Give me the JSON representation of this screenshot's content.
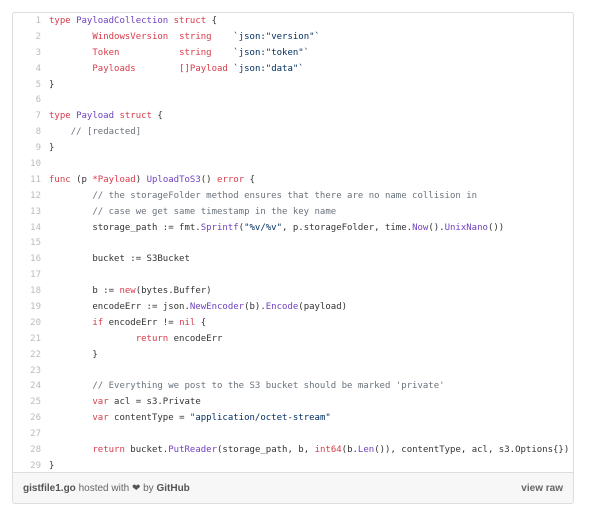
{
  "code_lines": [
    [
      {
        "t": "type ",
        "c": "k"
      },
      {
        "t": "PayloadCollection",
        "c": "f"
      },
      {
        "t": " ",
        "c": "tx"
      },
      {
        "t": "struct",
        "c": "k"
      },
      {
        "t": " {",
        "c": "tx"
      }
    ],
    [
      {
        "t": "        ",
        "c": "tx"
      },
      {
        "t": "WindowsVersion",
        "c": "k"
      },
      {
        "t": "  ",
        "c": "tx"
      },
      {
        "t": "string",
        "c": "k"
      },
      {
        "t": "    ",
        "c": "tx"
      },
      {
        "t": "`json:\"version\"`",
        "c": "s"
      }
    ],
    [
      {
        "t": "        ",
        "c": "tx"
      },
      {
        "t": "Token",
        "c": "k"
      },
      {
        "t": "           ",
        "c": "tx"
      },
      {
        "t": "string",
        "c": "k"
      },
      {
        "t": "    ",
        "c": "tx"
      },
      {
        "t": "`json:\"token\"`",
        "c": "s"
      }
    ],
    [
      {
        "t": "        ",
        "c": "tx"
      },
      {
        "t": "Payloads",
        "c": "k"
      },
      {
        "t": "        ",
        "c": "tx"
      },
      {
        "t": "[]Payload",
        "c": "k"
      },
      {
        "t": " ",
        "c": "tx"
      },
      {
        "t": "`json:\"data\"`",
        "c": "s"
      }
    ],
    [
      {
        "t": "}",
        "c": "tx"
      }
    ],
    [],
    [
      {
        "t": "type ",
        "c": "k"
      },
      {
        "t": "Payload",
        "c": "f"
      },
      {
        "t": " ",
        "c": "tx"
      },
      {
        "t": "struct",
        "c": "k"
      },
      {
        "t": " {",
        "c": "tx"
      }
    ],
    [
      {
        "t": "    ",
        "c": "tx"
      },
      {
        "t": "// [redacted]",
        "c": "c"
      }
    ],
    [
      {
        "t": "}",
        "c": "tx"
      }
    ],
    [],
    [
      {
        "t": "func",
        "c": "k"
      },
      {
        "t": " (p ",
        "c": "tx"
      },
      {
        "t": "*Payload",
        "c": "k"
      },
      {
        "t": ") ",
        "c": "tx"
      },
      {
        "t": "UploadToS3",
        "c": "f"
      },
      {
        "t": "() ",
        "c": "tx"
      },
      {
        "t": "error",
        "c": "k"
      },
      {
        "t": " {",
        "c": "tx"
      }
    ],
    [
      {
        "t": "        ",
        "c": "tx"
      },
      {
        "t": "// the storageFolder method ensures that there are no name collision in",
        "c": "c"
      }
    ],
    [
      {
        "t": "        ",
        "c": "tx"
      },
      {
        "t": "// case we get same timestamp in the key name",
        "c": "c"
      }
    ],
    [
      {
        "t": "        storage_path := fmt.",
        "c": "tx"
      },
      {
        "t": "Sprintf",
        "c": "f"
      },
      {
        "t": "(",
        "c": "tx"
      },
      {
        "t": "\"%v/%v\"",
        "c": "s"
      },
      {
        "t": ", p.storageFolder, time.",
        "c": "tx"
      },
      {
        "t": "Now",
        "c": "f"
      },
      {
        "t": "().",
        "c": "tx"
      },
      {
        "t": "UnixNano",
        "c": "f"
      },
      {
        "t": "())",
        "c": "tx"
      }
    ],
    [],
    [
      {
        "t": "        bucket := S3Bucket",
        "c": "tx"
      }
    ],
    [],
    [
      {
        "t": "        b := ",
        "c": "tx"
      },
      {
        "t": "new",
        "c": "k"
      },
      {
        "t": "(bytes.Buffer)",
        "c": "tx"
      }
    ],
    [
      {
        "t": "        encodeErr := json.",
        "c": "tx"
      },
      {
        "t": "NewEncoder",
        "c": "f"
      },
      {
        "t": "(b).",
        "c": "tx"
      },
      {
        "t": "Encode",
        "c": "f"
      },
      {
        "t": "(payload)",
        "c": "tx"
      }
    ],
    [
      {
        "t": "        ",
        "c": "tx"
      },
      {
        "t": "if",
        "c": "k"
      },
      {
        "t": " encodeErr != ",
        "c": "tx"
      },
      {
        "t": "nil",
        "c": "k"
      },
      {
        "t": " {",
        "c": "tx"
      }
    ],
    [
      {
        "t": "                ",
        "c": "tx"
      },
      {
        "t": "return",
        "c": "k"
      },
      {
        "t": " encodeErr",
        "c": "tx"
      }
    ],
    [
      {
        "t": "        }",
        "c": "tx"
      }
    ],
    [],
    [
      {
        "t": "        ",
        "c": "tx"
      },
      {
        "t": "// Everything we post to the S3 bucket should be marked 'private'",
        "c": "c"
      }
    ],
    [
      {
        "t": "        ",
        "c": "tx"
      },
      {
        "t": "var",
        "c": "k"
      },
      {
        "t": " acl = s3.Private",
        "c": "tx"
      }
    ],
    [
      {
        "t": "        ",
        "c": "tx"
      },
      {
        "t": "var",
        "c": "k"
      },
      {
        "t": " contentType = ",
        "c": "tx"
      },
      {
        "t": "\"application/octet-stream\"",
        "c": "s"
      }
    ],
    [],
    [
      {
        "t": "        ",
        "c": "tx"
      },
      {
        "t": "return",
        "c": "k"
      },
      {
        "t": " bucket.",
        "c": "tx"
      },
      {
        "t": "PutReader",
        "c": "f"
      },
      {
        "t": "(storage_path, b, ",
        "c": "tx"
      },
      {
        "t": "int64",
        "c": "k"
      },
      {
        "t": "(b.",
        "c": "tx"
      },
      {
        "t": "Len",
        "c": "f"
      },
      {
        "t": "()), contentType, acl, s3.Options{})",
        "c": "tx"
      }
    ],
    [
      {
        "t": "}",
        "c": "tx"
      }
    ]
  ],
  "footer": {
    "filename": "gistfile1.go",
    "hosted_text": " hosted with ",
    "by_text": " by ",
    "github": "GitHub",
    "heart_icon": "heart-icon",
    "view_raw": "view raw"
  }
}
